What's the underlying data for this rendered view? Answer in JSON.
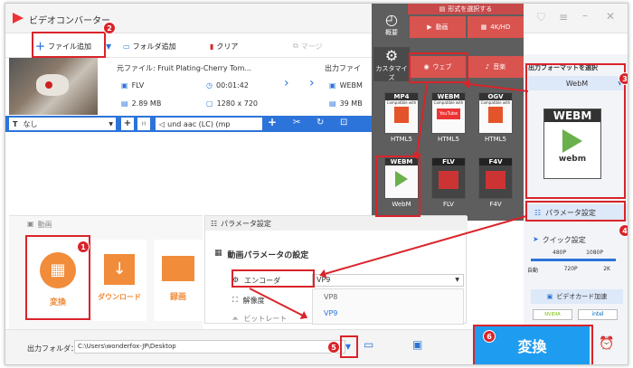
{
  "app": {
    "title": "ビデオコンバーター",
    "titlebar_icons": [
      "cart-icon",
      "menu-icon",
      "minimize-icon",
      "close-icon"
    ]
  },
  "toolbar": {
    "add_file": "ファイル追加",
    "add_folder": "フォルダ追加",
    "clear": "クリア",
    "merge": "マージ"
  },
  "file": {
    "source_name": "元ファイル: Fruit Plating-Cherry Tom...",
    "source_format": "FLV",
    "source_duration": "00:01:42",
    "source_size": "2.89 MB",
    "source_resolution": "1280 x 720",
    "output_label": "出力ファイ",
    "output_format": "WEBM",
    "output_size": "39 MB"
  },
  "subtitle_bar": {
    "subtitle_value": "なし",
    "audio_value": "und aac (LC) (mp"
  },
  "format_panel": {
    "header": "形式を選択する",
    "categories": [
      "概要",
      "動画",
      "4K/HD",
      "カスタマイズ",
      "ウェブ",
      "音楽"
    ],
    "formats": [
      {
        "name": "MP4",
        "caption": "HTML5",
        "sub": "Compatible with"
      },
      {
        "name": "WEBM",
        "caption": "HTML5",
        "sub": "Compatible with",
        "extra": "YouTube"
      },
      {
        "name": "OGV",
        "caption": "HTML5",
        "sub": "Compatible with"
      },
      {
        "name": "WEBM",
        "caption": "WebM"
      },
      {
        "name": "FLV",
        "caption": "FLV"
      },
      {
        "name": "F4V",
        "caption": "F4V"
      }
    ]
  },
  "output_panel": {
    "title": "出力フォーマットを選択",
    "selected": "WebM",
    "icon_text": "WEBM",
    "icon_sub": "webm",
    "param_button": "パラメータ設定",
    "quick_setting": "クイック設定",
    "quality_top": [
      "480P",
      "1080P"
    ],
    "quality_bottom": [
      "自動",
      "720P",
      "2K"
    ],
    "gpu_label": "ビデオカード加速",
    "gpu_vendors": [
      "NVIDIA",
      "intel"
    ]
  },
  "tools": {
    "tab_label": "動画",
    "items": [
      {
        "label": "変換"
      },
      {
        "label": "ダウンロード"
      },
      {
        "label": "録画"
      }
    ]
  },
  "param_dialog": {
    "title": "パラメータ設定",
    "section": "動画パラメータの設定",
    "encoder_label": "エンコーダ",
    "encoder_value": "VP9",
    "resolution_label": "解像度",
    "bitrate_label": "ビットレート",
    "options": [
      "VP8",
      "VP9"
    ]
  },
  "bottom": {
    "folder_label": "出力フォルダ：",
    "folder_path": "C:\\Users\\wonderfox-JP\\Desktop",
    "convert": "変換"
  },
  "badges": [
    "1",
    "2",
    "3",
    "4",
    "5",
    "6"
  ]
}
